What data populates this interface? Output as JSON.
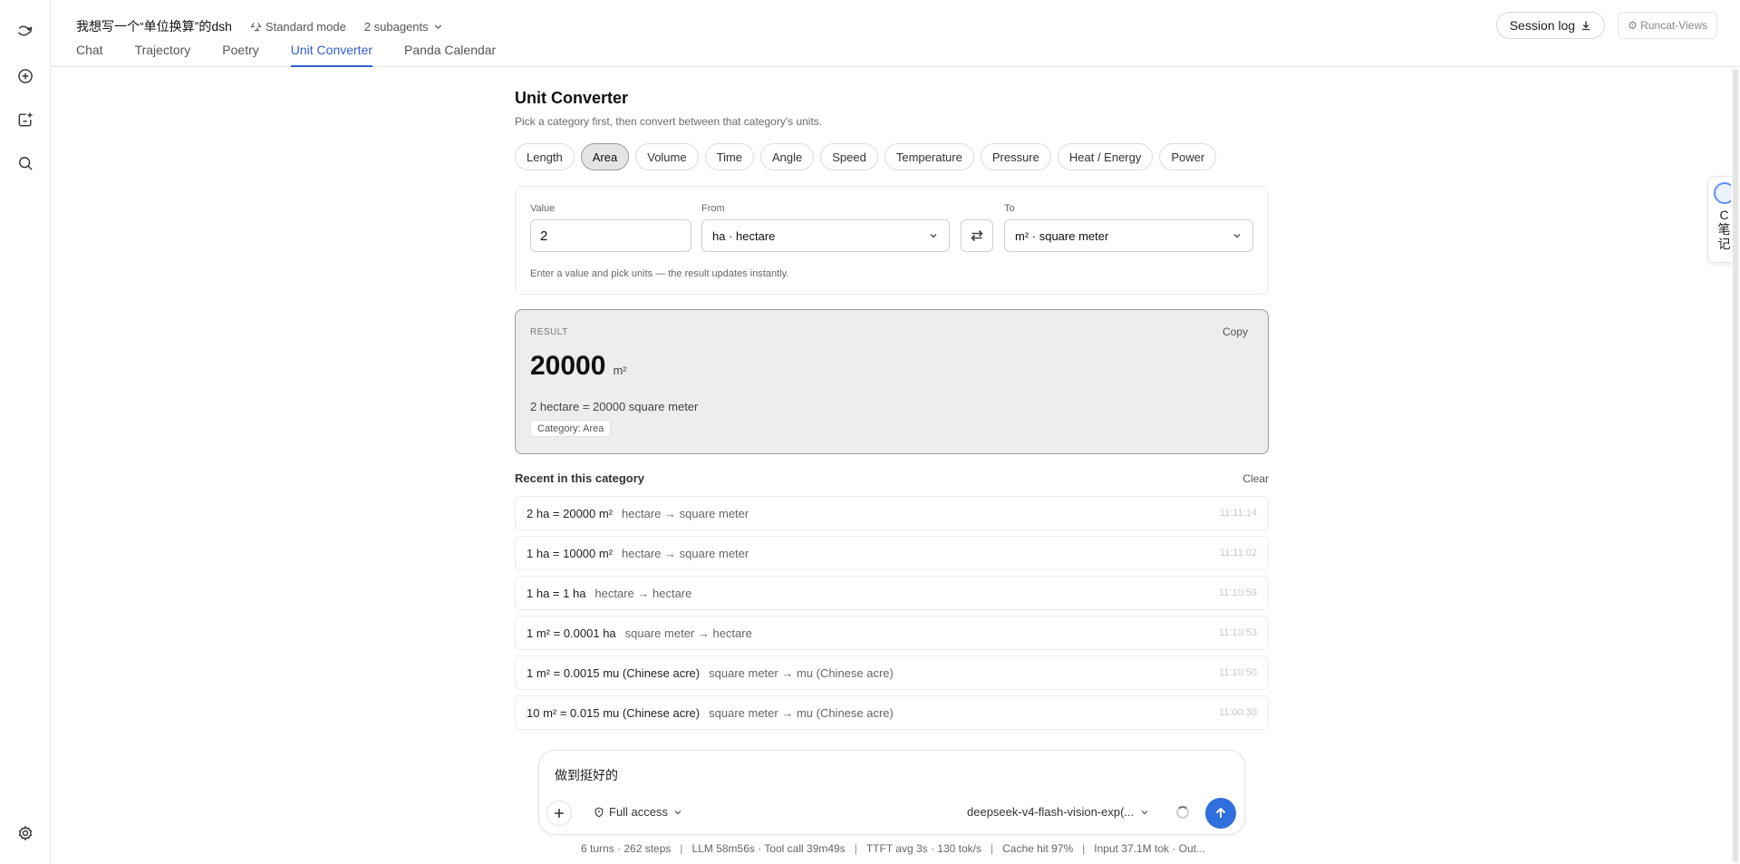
{
  "header": {
    "session_title": "我想写一个“单位换算”的dsh",
    "mode": "Standard mode",
    "subagents": "2 subagents",
    "session_log": "Session log",
    "views": "⚙ Runcat-Views"
  },
  "tabs": [
    {
      "label": "Chat"
    },
    {
      "label": "Trajectory"
    },
    {
      "label": "Poetry"
    },
    {
      "label": "Unit Converter",
      "active": true
    },
    {
      "label": "Panda Calendar"
    }
  ],
  "sidebar": {
    "icons": [
      "app-logo-icon",
      "new-chat-icon",
      "new-project-icon",
      "search-icon",
      "settings-icon"
    ]
  },
  "note_widget": {
    "lines": [
      "C",
      "笔",
      "记"
    ]
  },
  "converter": {
    "title": "Unit Converter",
    "subtitle": "Pick a category first, then convert between that category's units.",
    "categories": [
      {
        "label": "Length"
      },
      {
        "label": "Area",
        "active": true
      },
      {
        "label": "Volume"
      },
      {
        "label": "Time"
      },
      {
        "label": "Angle"
      },
      {
        "label": "Speed"
      },
      {
        "label": "Temperature"
      },
      {
        "label": "Pressure"
      },
      {
        "label": "Heat / Energy"
      },
      {
        "label": "Power"
      }
    ],
    "value_label": "Value",
    "value": "2",
    "from_label": "From",
    "from_value": "ha · hectare",
    "to_label": "To",
    "to_value": "m² · square meter",
    "hint": "Enter a value and pick units — the result updates instantly."
  },
  "result": {
    "label": "RESULT",
    "copy": "Copy",
    "number": "20000",
    "unit": "m²",
    "equation": "2 hectare = 20000 square meter",
    "category": "Category: Area"
  },
  "recent": {
    "heading": "Recent in this category",
    "clear": "Clear",
    "items": [
      {
        "expr": "2 ha = 20000 m²",
        "desc": "hectare → square meter",
        "time": "11:11:14"
      },
      {
        "expr": "1 ha = 10000 m²",
        "desc": "hectare → square meter",
        "time": "11:11:02"
      },
      {
        "expr": "1 ha = 1 ha",
        "desc": "hectare → hectare",
        "time": "11:10:59"
      },
      {
        "expr": "1 m² = 0.0001 ha",
        "desc": "square meter → hectare",
        "time": "11:10:53"
      },
      {
        "expr": "1 m² = 0.0015 mu (Chinese acre)",
        "desc": "square meter → mu (Chinese acre)",
        "time": "11:10:50"
      },
      {
        "expr": "10 m² = 0.015 mu (Chinese acre)",
        "desc": "square meter → mu (Chinese acre)",
        "time": "11:00:30"
      }
    ]
  },
  "composer": {
    "text": "做到挺好的",
    "access": "Full access",
    "model": "deepseek-v4-flash-vision-exp(...",
    "send_color": "#2f6fde"
  },
  "status": {
    "items": [
      "6 turns · 262 steps",
      "LLM 58m56s · Tool call 39m49s",
      "TTFT avg 3s · 130 tok/s",
      "Cache hit 97%",
      "Input 37.1M tok · Out..."
    ]
  }
}
